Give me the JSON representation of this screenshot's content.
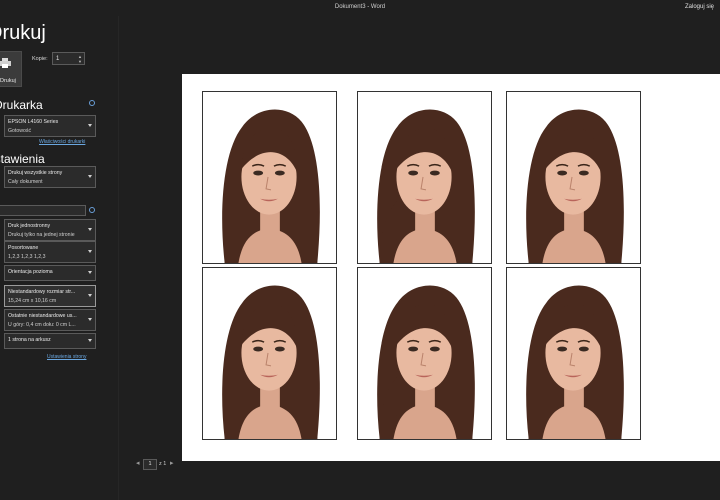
{
  "titlebar": {
    "document_title": "Dokument3  -  Word",
    "sign_in": "Zaloguj się"
  },
  "print": {
    "heading": "Drukuj",
    "print_button_label": "Drukuj",
    "copies_label": "Kopie:",
    "copies_value": "1"
  },
  "printer": {
    "section_title": "Drukarka",
    "name": "EPSON L4160 Series",
    "status": "Gotowość",
    "properties_link": "Właściwości drukarki"
  },
  "settings": {
    "section_title": "Ustawienia",
    "print_range": {
      "line1": "Drukuj wszystkie strony",
      "line2": "Cały dokument"
    },
    "pages_placeholder": "",
    "sides": {
      "line1": "Druk jednostronny",
      "line2": "Drukuj tylko na jednej stronie"
    },
    "collation": {
      "line1": "Posortowane",
      "line2": "1,2,3    1,2,3    1,2,3"
    },
    "orientation": {
      "line1": "Orientacja pozioma"
    },
    "paper_size": {
      "line1": "Niestandardowy rozmiar str...",
      "line2": "15,24  cm x 10,16  cm"
    },
    "margins": {
      "line1": "Ostatnie niestandardowe us...",
      "line2": "U góry: 0,4  cm dołu: 0  cm L..."
    },
    "pages_per_sheet": {
      "line1": "1 strona na arkusz"
    },
    "page_setup_link": "Ustawienia strony"
  },
  "preview": {
    "photo_count": 6
  },
  "pager": {
    "prev": "◂",
    "current_page": "1",
    "of_label": "z 1",
    "next": "▸"
  },
  "colors": {
    "background": "#1f1f1f",
    "dropdown_bg": "#2b2b2b",
    "link": "#6aa7e0",
    "paper": "#ffffff"
  }
}
